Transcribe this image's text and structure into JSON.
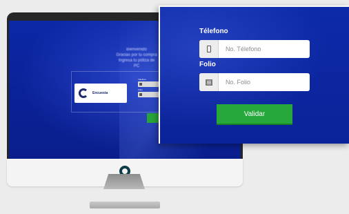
{
  "screen": {
    "welcome_lines": [
      "Bienvenido",
      "Gracias por tu compra",
      "Ingresa tu póliza de",
      "PC"
    ],
    "logo_text": "Encuesta"
  },
  "form": {
    "telefono_label": "Télefono",
    "telefono_placeholder": "No. Télefono",
    "telefono_icon": "phone-icon",
    "folio_label": "Folio",
    "folio_placeholder": "No. Folio",
    "folio_icon": "document-icon",
    "validate_label": "Validar"
  },
  "colors": {
    "screen_blue": "#0c28a6",
    "validate_green": "#26a83a",
    "power_ring": "#0d3b48"
  }
}
